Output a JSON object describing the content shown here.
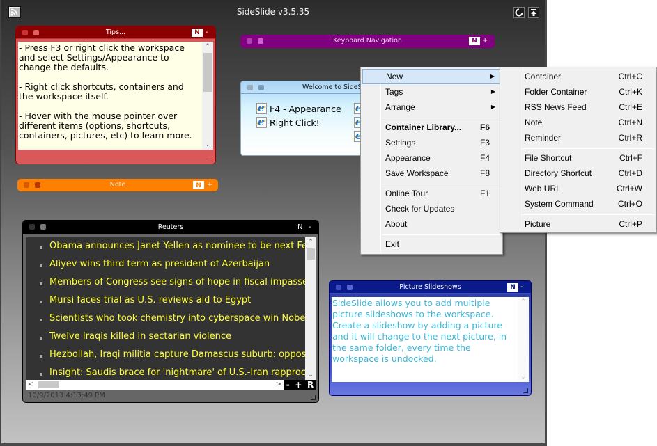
{
  "app": {
    "title": "SideSlide v3.5.35",
    "icons": {
      "feed": "rss-feed-icon",
      "refresh": "refresh-icon",
      "collapse": "dock-collapse-icon"
    }
  },
  "tips": {
    "title": "Tips...",
    "n_label": "N",
    "toggle": "-",
    "text": "- Press F3 or right click the workspace\nand select Settings/Appearance to\nchange the defaults.\n\n- Right click shortcuts, containers and\nthe workspace itself.\n\n- Hover with the mouse pointer over\ndifferent items (options, shortcuts,\ncontainers, pictures, etc) to learn more.",
    "color": "#8b0000"
  },
  "keyboard_nav": {
    "title": "Keyboard Navigation",
    "n_label": "N",
    "toggle": "+",
    "color": "#800080"
  },
  "welcome": {
    "title": "Welcome to SideSlide",
    "shortcuts": [
      {
        "label": "F4 - Appearance",
        "icon": "internet-explorer-icon"
      },
      {
        "label": "Right Click!",
        "icon": "internet-explorer-icon"
      }
    ]
  },
  "note": {
    "title": "Note",
    "n_label": "N",
    "toggle": "+",
    "color": "#ff8000"
  },
  "reuters": {
    "title": "Reuters",
    "n_label": "N",
    "toggle": "-",
    "items": [
      "Obama announces Janet Yellen as nominee to be next Fed chief",
      "Aliyev wins third term as president of Azerbaijan",
      "Members of Congress see signs of hope in fiscal impasse",
      "Mursi faces trial as U.S. reviews aid to Egypt",
      "Scientists who took chemistry into cyberspace win Nobel Prize",
      "Twelve Iraqis killed in sectarian violence",
      "Hezbollah, Iraqi militia capture Damascus suburb: opposition",
      "Insight: Saudis brace for 'nightmare' of U.S.-Iran rapprochement"
    ],
    "zoom_out": "-",
    "zoom_in": "+",
    "refresh": "R",
    "timestamp": "10/9/2013 4:13:49 PM"
  },
  "pictures": {
    "title": "Picture Slideshows",
    "n_label": "N",
    "toggle": "-",
    "text": "SideSlide allows you to add multiple picture slideshows to the workspace. Create a slideshow by adding a picture and it will change to the next picture, in the same folder, every time the workspace is undocked.",
    "color": "#0a1a8a"
  },
  "context_menu": {
    "items": [
      {
        "label": "New",
        "submenu": true,
        "highlighted": true
      },
      {
        "label": "Tags",
        "submenu": true
      },
      {
        "label": "Arrange",
        "submenu": true
      },
      {
        "label": "Container Library...",
        "key": "F6",
        "bold": true
      },
      {
        "label": "Settings",
        "key": "F3"
      },
      {
        "label": "Appearance",
        "key": "F4"
      },
      {
        "label": "Save Workspace",
        "key": "F8"
      },
      {
        "label": "Online Tour",
        "key": "F1"
      },
      {
        "label": "Check for Updates"
      },
      {
        "label": "About"
      },
      {
        "label": "Exit"
      }
    ]
  },
  "new_submenu": {
    "items": [
      {
        "label": "Container",
        "key": "Ctrl+C"
      },
      {
        "label": "Folder Container",
        "key": "Ctrl+K"
      },
      {
        "label": "RSS News Feed",
        "key": "Ctrl+E"
      },
      {
        "label": "Note",
        "key": "Ctrl+N"
      },
      {
        "label": "Reminder",
        "key": "Ctrl+R"
      },
      {
        "label": "File Shortcut",
        "key": "Ctrl+F"
      },
      {
        "label": "Directory Shortcut",
        "key": "Ctrl+D"
      },
      {
        "label": "Web URL",
        "key": "Ctrl+W"
      },
      {
        "label": "System Command",
        "key": "Ctrl+O"
      },
      {
        "label": "Picture",
        "key": "Ctrl+P"
      }
    ]
  }
}
